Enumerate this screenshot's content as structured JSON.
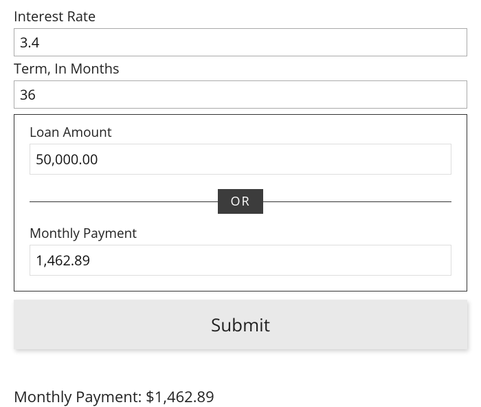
{
  "form": {
    "interestRate": {
      "label": "Interest Rate",
      "value": "3.4"
    },
    "term": {
      "label": "Term, In Months",
      "value": "36"
    },
    "loanAmount": {
      "label": "Loan Amount",
      "value": "50,000.00"
    },
    "divider": "OR",
    "monthlyPayment": {
      "label": "Monthly Payment",
      "value": "1,462.89"
    },
    "submitLabel": "Submit"
  },
  "result": "Monthly Payment: $1,462.89"
}
